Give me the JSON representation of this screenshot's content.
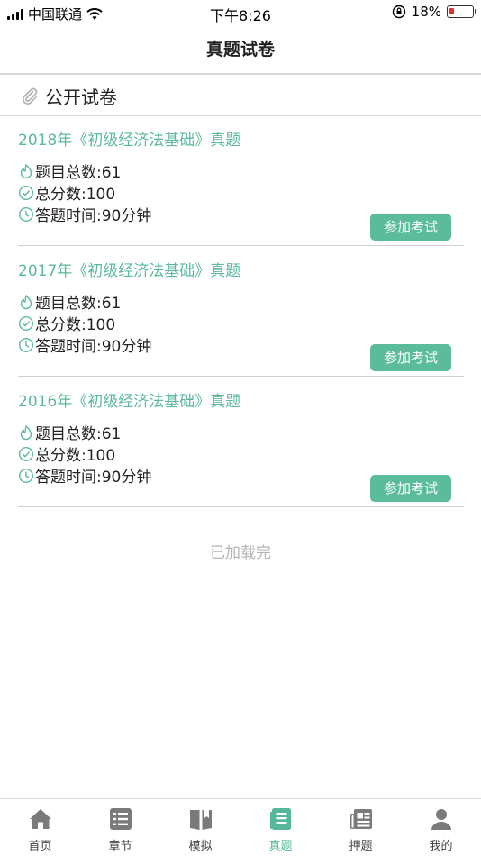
{
  "status_bar": {
    "carrier": "中国联通",
    "time": "下午8:26",
    "battery_percent": "18%",
    "battery_level": 0.18
  },
  "nav": {
    "title": "真题试卷"
  },
  "section": {
    "title": "公开试卷",
    "icon": "paperclip-icon"
  },
  "exams": [
    {
      "title": "2018年《初级经济法基础》真题",
      "question_count": "题目总数:61",
      "total_score": "总分数:100",
      "time_limit": "答题时间:90分钟",
      "button": "参加考试"
    },
    {
      "title": "2017年《初级经济法基础》真题",
      "question_count": "题目总数:61",
      "total_score": "总分数:100",
      "time_limit": "答题时间:90分钟",
      "button": "参加考试"
    },
    {
      "title": "2016年《初级经济法基础》真题",
      "question_count": "题目总数:61",
      "total_score": "总分数:100",
      "time_limit": "答题时间:90分钟",
      "button": "参加考试"
    }
  ],
  "list_end": "已加载完",
  "tabs": [
    {
      "label": "首页",
      "icon": "home-icon"
    },
    {
      "label": "章节",
      "icon": "list-icon"
    },
    {
      "label": "模拟",
      "icon": "book-icon"
    },
    {
      "label": "真题",
      "icon": "document-icon",
      "active": true
    },
    {
      "label": "押题",
      "icon": "newspaper-icon"
    },
    {
      "label": "我的",
      "icon": "person-icon"
    }
  ],
  "colors": {
    "accent": "#5bb8a1",
    "button": "#5bbc9c",
    "muted": "#b4b4b4",
    "battery_low": "#e0302a"
  }
}
